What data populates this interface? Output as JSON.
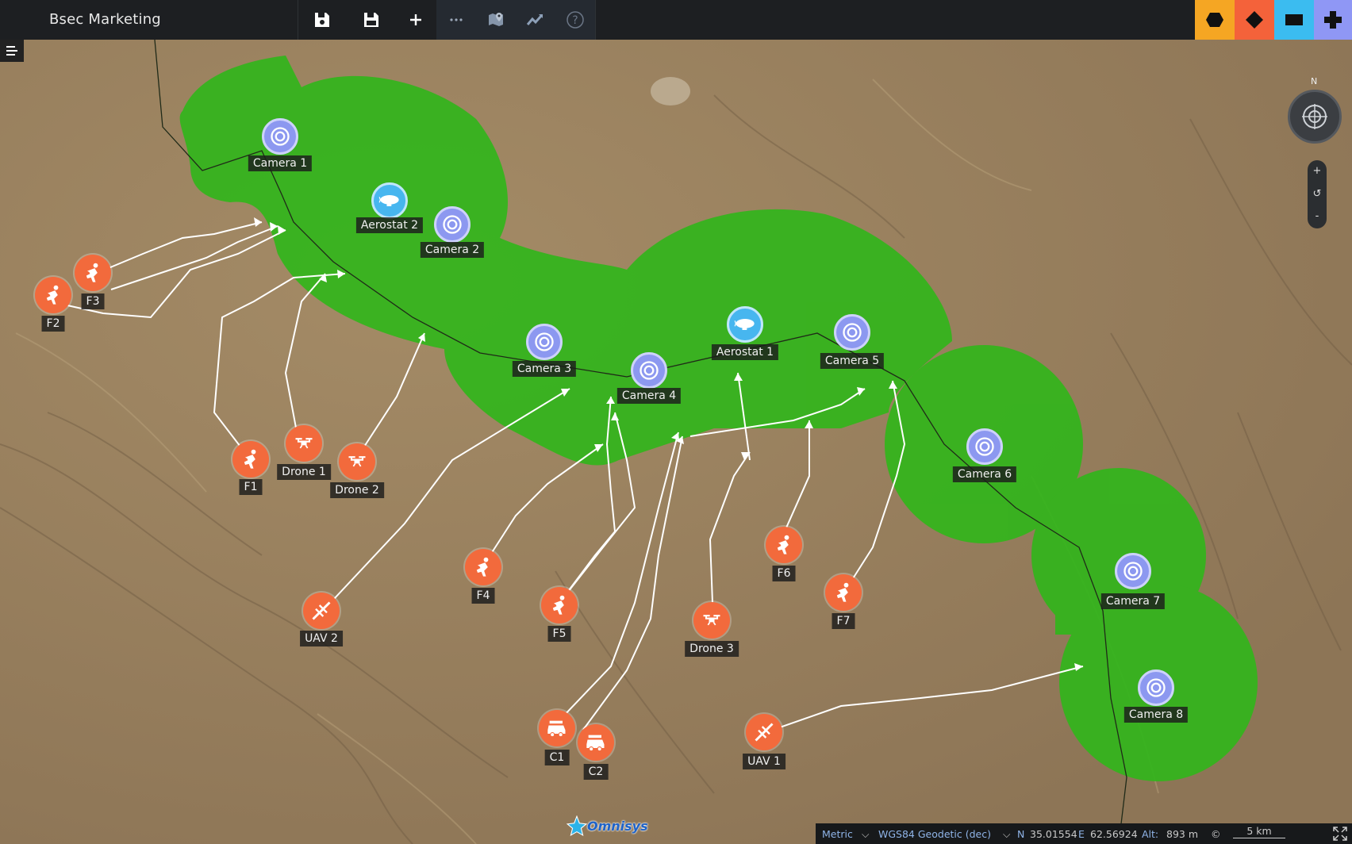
{
  "app": {
    "title": "Bsec Marketing"
  },
  "toolbar": {
    "buttons": [
      {
        "name": "save-icon"
      },
      {
        "name": "save-as-icon"
      },
      {
        "name": "add-icon"
      },
      {
        "name": "more-icon"
      },
      {
        "name": "map-pin-icon"
      },
      {
        "name": "trend-icon"
      },
      {
        "name": "help-icon"
      }
    ],
    "shape_tools": [
      {
        "name": "hexagon-icon",
        "color": "#f5a623"
      },
      {
        "name": "diamond-icon",
        "color": "#f4623a"
      },
      {
        "name": "rectangle-icon",
        "color": "#3bbcf0"
      },
      {
        "name": "cross-icon",
        "color": "#8f97f5"
      }
    ]
  },
  "map": {
    "compass_label": "N",
    "zoom_in": "+",
    "zoom_reset": "↺",
    "zoom_out": "-",
    "coverage_color": "#33b51c",
    "assets": [
      {
        "label": "Camera 1",
        "type": "camera"
      },
      {
        "label": "Aerostat 2",
        "type": "aerostat"
      },
      {
        "label": "Camera 2",
        "type": "camera"
      },
      {
        "label": "Camera 3",
        "type": "camera"
      },
      {
        "label": "Camera 4",
        "type": "camera"
      },
      {
        "label": "Aerostat 1",
        "type": "aerostat"
      },
      {
        "label": "Camera 5",
        "type": "camera"
      },
      {
        "label": "Camera 6",
        "type": "camera"
      },
      {
        "label": "Camera 7",
        "type": "camera"
      },
      {
        "label": "Camera 8",
        "type": "camera"
      },
      {
        "label": "F3",
        "type": "infantry"
      },
      {
        "label": "F2",
        "type": "infantry"
      },
      {
        "label": "F1",
        "type": "infantry"
      },
      {
        "label": "Drone 1",
        "type": "drone"
      },
      {
        "label": "Drone 2",
        "type": "drone"
      },
      {
        "label": "F4",
        "type": "infantry"
      },
      {
        "label": "F5",
        "type": "infantry"
      },
      {
        "label": "UAV 2",
        "type": "uav"
      },
      {
        "label": "Drone 3",
        "type": "drone"
      },
      {
        "label": "F6",
        "type": "infantry"
      },
      {
        "label": "F7",
        "type": "infantry"
      },
      {
        "label": "C1",
        "type": "vehicle"
      },
      {
        "label": "C2",
        "type": "vehicle"
      },
      {
        "label": "UAV 1",
        "type": "uav"
      }
    ],
    "logo_text": "Omnisys"
  },
  "status": {
    "units": "Metric",
    "crs": "WGS84 Geodetic (dec)",
    "n_label": "N",
    "n_value": "35.01554",
    "e_label": "E",
    "e_value": "62.56924",
    "alt_label": "Alt:",
    "alt_value": "893 m",
    "copyright": "©",
    "scale": "5 km"
  }
}
